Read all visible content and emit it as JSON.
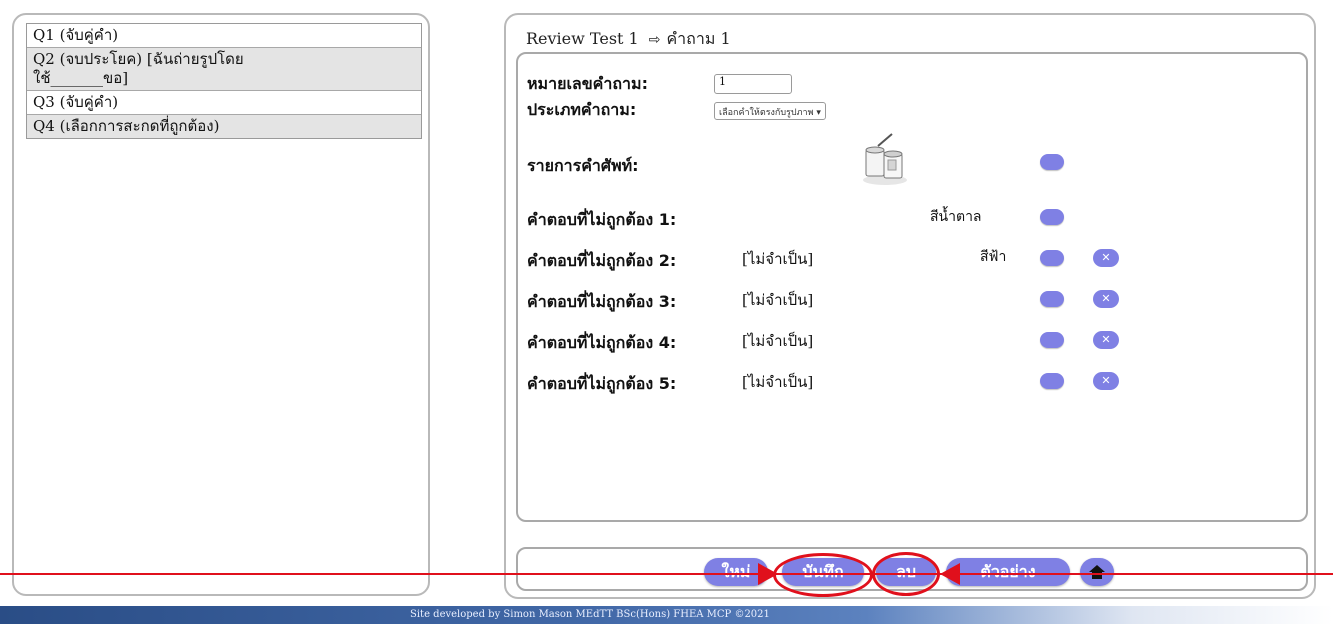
{
  "questions": [
    {
      "label": "Q1 (จับคู่คำ)"
    },
    {
      "label": "Q2 (จบประโยค) [ฉันถ่ายรูปโดย\nใช้_______ขอ]"
    },
    {
      "label": "Q3 (จับคู่คำ)"
    },
    {
      "label": "Q4 (เลือกการสะกดที่ถูกต้อง)"
    }
  ],
  "header": {
    "test_name": "Review Test 1",
    "arrow": "⇨",
    "question_label": "คำถาม 1"
  },
  "form": {
    "number_label": "หมายเลขคำถาม:",
    "number_value": "1",
    "type_label": "ประเภทคำถาม:",
    "type_value": "เลือกคำให้ตรงกับรูปภาพ",
    "vocab_label": "รายการคำศัพท์:",
    "wrong_answers": [
      {
        "label": "คำตอบที่ไม่ถูกต้อง 1:",
        "optional": "",
        "value": "สีน้ำตาล"
      },
      {
        "label": "คำตอบที่ไม่ถูกต้อง 2:",
        "optional": "[ไม่จำเป็น]",
        "value": "สีฟ้า"
      },
      {
        "label": "คำตอบที่ไม่ถูกต้อง 3:",
        "optional": "[ไม่จำเป็น]",
        "value": ""
      },
      {
        "label": "คำตอบที่ไม่ถูกต้อง 4:",
        "optional": "[ไม่จำเป็น]",
        "value": ""
      },
      {
        "label": "คำตอบที่ไม่ถูกต้อง 5:",
        "optional": "[ไม่จำเป็น]",
        "value": ""
      }
    ],
    "pill_label": "...",
    "remove_label": "✕"
  },
  "buttons": {
    "new": "ใหม่",
    "save": "บันทึก",
    "delete": "ลบ",
    "example": "ตัวอย่าง",
    "home_icon": "home-icon"
  },
  "footer": {
    "text": "Site developed by Simon Mason  MEdTT  BSc(Hons)  FHEA  MCP  ©2021"
  },
  "colors": {
    "button": "#7f80e4",
    "annotation": "#e0101c",
    "footer": "#2a4d86"
  }
}
